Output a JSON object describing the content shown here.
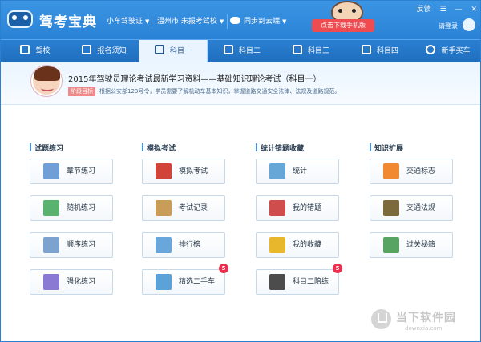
{
  "app": {
    "title": "驾考宝典",
    "license_selector": "小车驾驶证",
    "region_selector": "温州市 未报考驾校",
    "sync_label": "同步到云端",
    "download_button": "点击下载手机版",
    "login_label": "请登录"
  },
  "window_controls": {
    "feedback": "反馈",
    "menu": "☰",
    "minimize": "—",
    "close": "✕"
  },
  "nav": [
    {
      "label": "驾校",
      "icon": "school-icon"
    },
    {
      "label": "报名须知",
      "icon": "document-icon"
    },
    {
      "label": "科目一",
      "icon": "exam-icon",
      "active": true
    },
    {
      "label": "科目二",
      "icon": "cone-icon"
    },
    {
      "label": "科目三",
      "icon": "car-icon"
    },
    {
      "label": "科目四",
      "icon": "book-icon"
    },
    {
      "label": "新手买车",
      "icon": "steering-wheel-icon"
    }
  ],
  "banner": {
    "headline": "2015年驾驶员理论考试最新学习资料——基础知识理论考试（科目一）",
    "stage_badge": "阶段目标",
    "description": "根据公安部123号令，学员需要了解机动车基本知识，掌握道路交通安全法律、法规及道路规范。"
  },
  "sections": [
    {
      "title": "试题练习",
      "items": [
        {
          "label": "章节练习",
          "icon": "chapter-practice-icon",
          "color": "#6f9fd6"
        },
        {
          "label": "随机练习",
          "icon": "random-practice-icon",
          "color": "#59b36f"
        },
        {
          "label": "顺序练习",
          "icon": "sequence-practice-icon",
          "color": "#7ca2cf"
        },
        {
          "label": "强化练习",
          "icon": "intensive-practice-icon",
          "color": "#8b7ad3"
        }
      ]
    },
    {
      "title": "模拟考试",
      "items": [
        {
          "label": "模拟考试",
          "icon": "mock-exam-icon",
          "color": "#d0443a"
        },
        {
          "label": "考试记录",
          "icon": "exam-record-icon",
          "color": "#c99c57"
        },
        {
          "label": "排行榜",
          "icon": "ranking-icon",
          "color": "#69a6dc"
        },
        {
          "label": "精选二手车",
          "icon": "used-truck-icon",
          "color": "#5ba2d9",
          "badge": "5"
        }
      ]
    },
    {
      "title": "统计错题收藏",
      "items": [
        {
          "label": "统计",
          "icon": "statistics-icon",
          "color": "#67a7d8"
        },
        {
          "label": "我的错题",
          "icon": "wrong-questions-icon",
          "color": "#cf4d4d"
        },
        {
          "label": "我的收藏",
          "icon": "favorite-star-icon",
          "color": "#e8b72b"
        },
        {
          "label": "科目二陪练",
          "icon": "coach-pin-icon",
          "color": "#4c4c4c",
          "badge": "5"
        }
      ]
    },
    {
      "title": "知识扩展",
      "items": [
        {
          "label": "交通标志",
          "icon": "traffic-cone-icon",
          "color": "#f0892f"
        },
        {
          "label": "交通法规",
          "icon": "traffic-police-icon",
          "color": "#7d6a3c"
        },
        {
          "label": "过关秘籍",
          "icon": "guide-book-icon",
          "color": "#57a463"
        }
      ]
    }
  ],
  "watermark": {
    "brand": "当下软件园",
    "url": "downxia.com"
  }
}
